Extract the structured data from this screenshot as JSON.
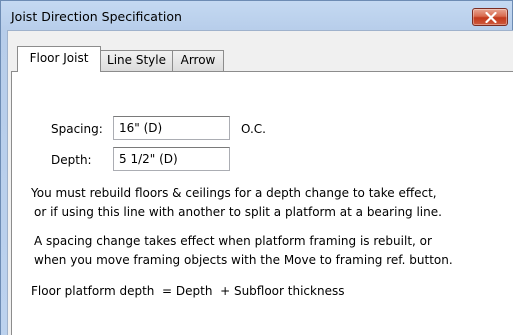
{
  "window": {
    "title": "Joist Direction Specification"
  },
  "tabs": [
    {
      "label": "Floor Joist",
      "active": true
    },
    {
      "label": "Line Style",
      "active": false
    },
    {
      "label": "Arrow",
      "active": false
    }
  ],
  "form": {
    "spacing_label": "Spacing:",
    "spacing_value": "16\" (D)",
    "spacing_suffix": "O.C.",
    "depth_label": "Depth:",
    "depth_value": "5 1/2\" (D)"
  },
  "notes": {
    "rebuild_line1": "You must rebuild floors & ceilings for a depth change to take effect,",
    "rebuild_line2": "or if using this line with another to split a platform at a bearing line.",
    "spacing_line1": "A spacing change takes effect when platform framing is rebuilt, or",
    "spacing_line2": "when you move framing objects with the Move to framing ref. button.",
    "formula": "Floor platform depth  = Depth  + Subfloor thickness"
  },
  "colors": {
    "titlebar": "#bcd2ee",
    "close_button": "#c7432a",
    "panel_background": "#ffffff"
  }
}
